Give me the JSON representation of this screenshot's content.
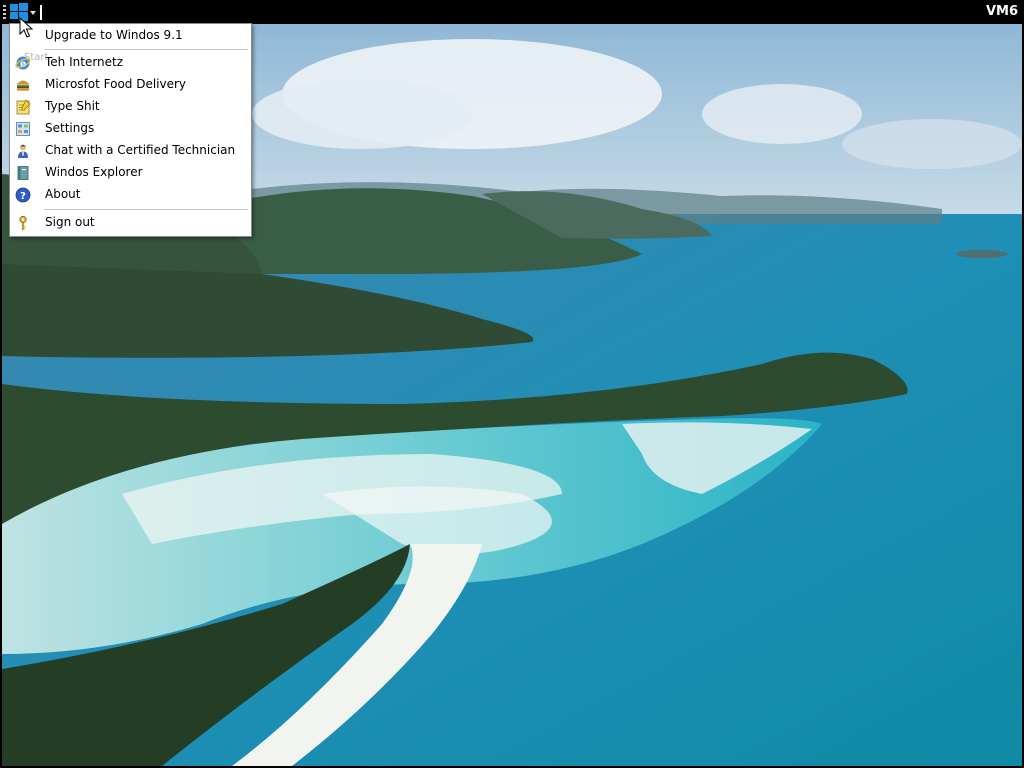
{
  "topbar": {
    "vm_label": "VM6",
    "start_icon": "windows-logo-icon",
    "start_ghost_label": "Start"
  },
  "start_menu": {
    "header_item": {
      "label": "Upgrade to Windos 9.1"
    },
    "items": [
      {
        "label": "Teh Internetz",
        "icon": "internet-explorer-icon"
      },
      {
        "label": "Microsfot Food Delivery",
        "icon": "burger-icon"
      },
      {
        "label": "Type Shit",
        "icon": "notepad-icon"
      },
      {
        "label": "Settings",
        "icon": "control-panel-icon"
      },
      {
        "label": "Chat with a Certified Technician",
        "icon": "technician-user-icon"
      },
      {
        "label": "Windos Explorer",
        "icon": "book-icon"
      },
      {
        "label": "About",
        "icon": "help-icon"
      }
    ],
    "footer_item": {
      "label": "Sign out",
      "icon": "key-icon"
    }
  },
  "desktop": {
    "wallpaper": "tropical-island-aerial"
  },
  "colors": {
    "taskbar": "#000000",
    "menu_bg": "#ffffff",
    "windows_blue": "#1e90e0",
    "sea": "#1e9bb5",
    "forest": "#2e4d2c",
    "sand": "#eef2f0"
  }
}
